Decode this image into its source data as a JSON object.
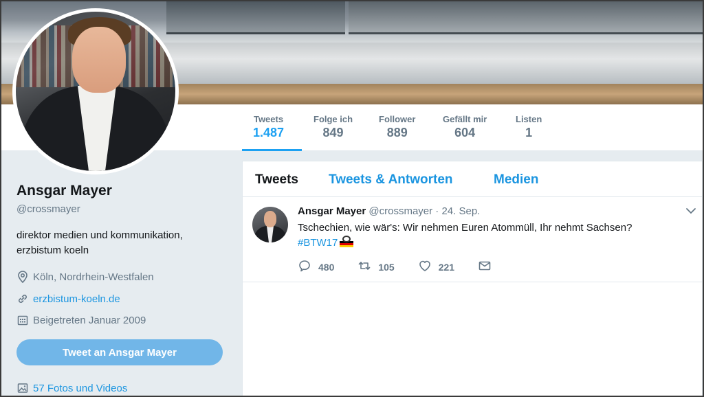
{
  "profile": {
    "name": "Ansgar Mayer",
    "handle": "@crossmayer",
    "bio_line1": "direktor medien und kommunikation,",
    "bio_line2": "erzbistum koeln",
    "location": "Köln, Nordrhein-Westfalen",
    "website": "erzbistum-koeln.de",
    "joined": "Beigetreten Januar 2009",
    "tweet_to_label": "Tweet an Ansgar Mayer",
    "media_link": "57 Fotos und Videos"
  },
  "stats": [
    {
      "label": "Tweets",
      "value": "1.487",
      "active": true
    },
    {
      "label": "Folge ich",
      "value": "849"
    },
    {
      "label": "Follower",
      "value": "889"
    },
    {
      "label": "Gefällt mir",
      "value": "604"
    },
    {
      "label": "Listen",
      "value": "1"
    }
  ],
  "tabs": [
    {
      "label": "Tweets",
      "active": true
    },
    {
      "label": "Tweets & Antworten"
    },
    {
      "label": "Medien"
    }
  ],
  "tweet": {
    "name": "Ansgar Mayer",
    "handle_date": "@crossmayer · 24. Sep.",
    "text": "Tschechien, wie wär's: Wir nehmen Euren Atommüll, Ihr nehmt Sachsen?",
    "hashtag": "#BTW17",
    "replies": "480",
    "retweets": "105",
    "likes": "221"
  },
  "colors": {
    "accent": "#1da1f2",
    "link": "#1b95e0",
    "button": "#71b6e8",
    "background": "#e6ecf0"
  },
  "icons": [
    "location-pin-icon",
    "link-icon",
    "calendar-icon",
    "photo-icon",
    "chevron-down-icon",
    "reply-icon",
    "retweet-icon",
    "like-icon",
    "direct-message-icon"
  ]
}
